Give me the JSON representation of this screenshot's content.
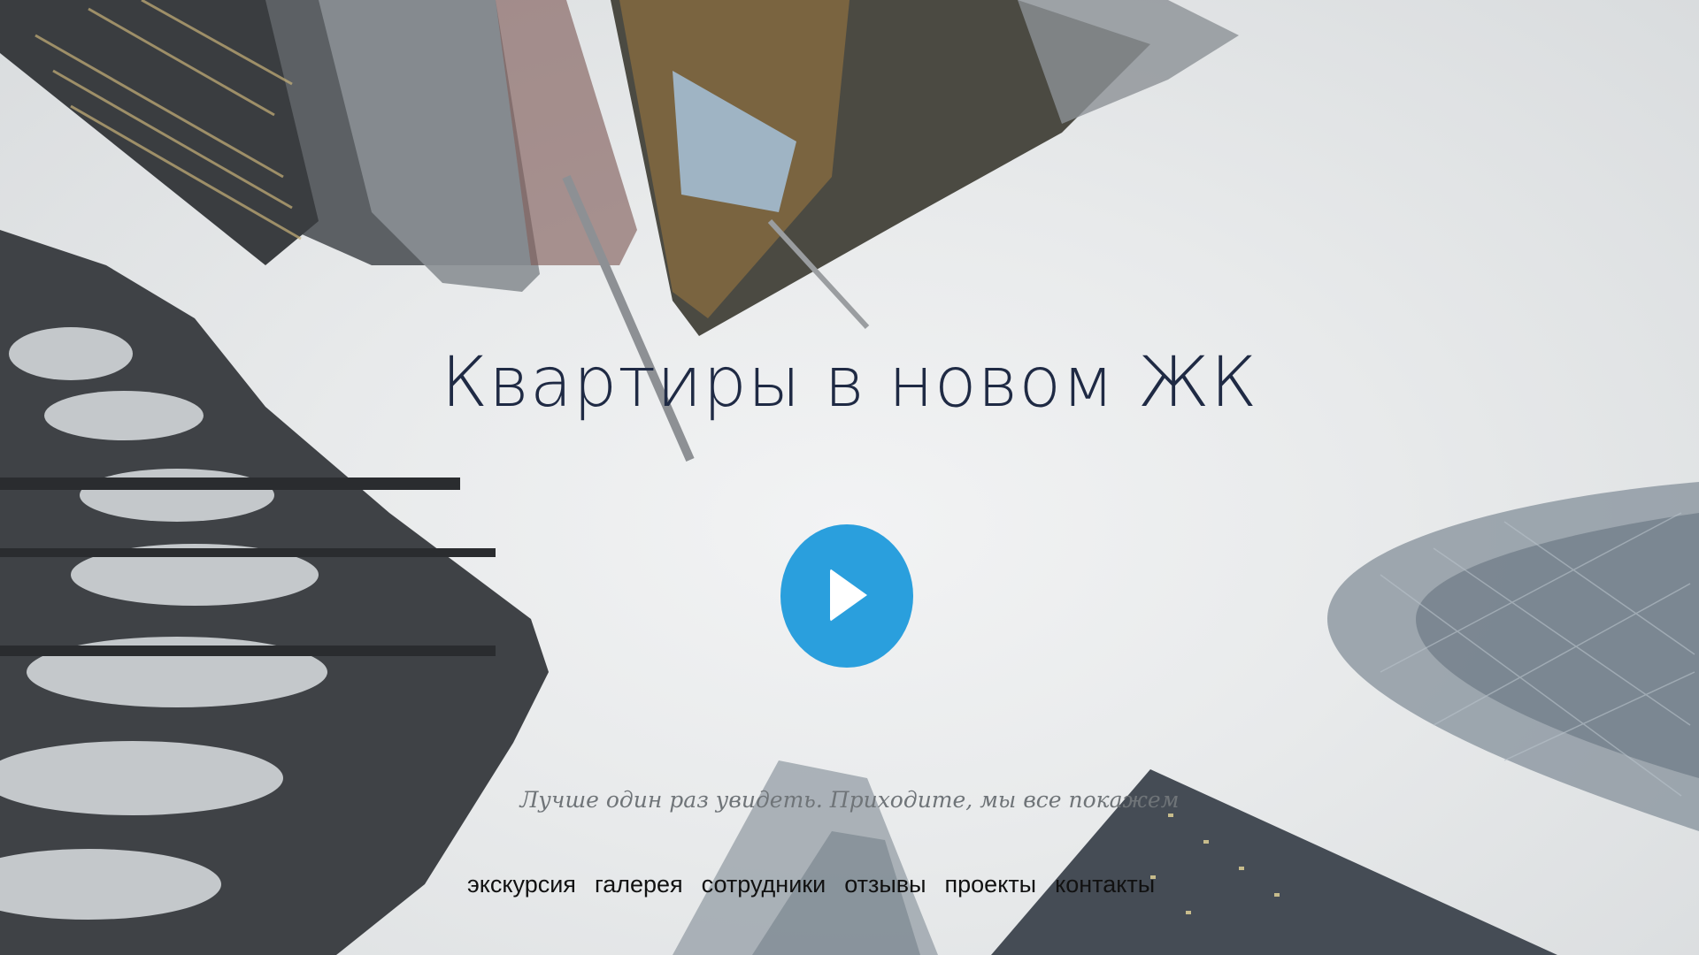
{
  "hero": {
    "title": "Квартиры в новом ЖК",
    "play_button_icon": "play-icon",
    "tagline": "Лучше один раз увидеть. Приходите, мы все покажем",
    "accent_color": "#2a9fdd"
  },
  "nav": {
    "items": [
      {
        "label": "экскурсия"
      },
      {
        "label": "галерея"
      },
      {
        "label": "сотрудники"
      },
      {
        "label": "отзывы"
      },
      {
        "label": "проекты"
      },
      {
        "label": "контакты"
      }
    ]
  }
}
